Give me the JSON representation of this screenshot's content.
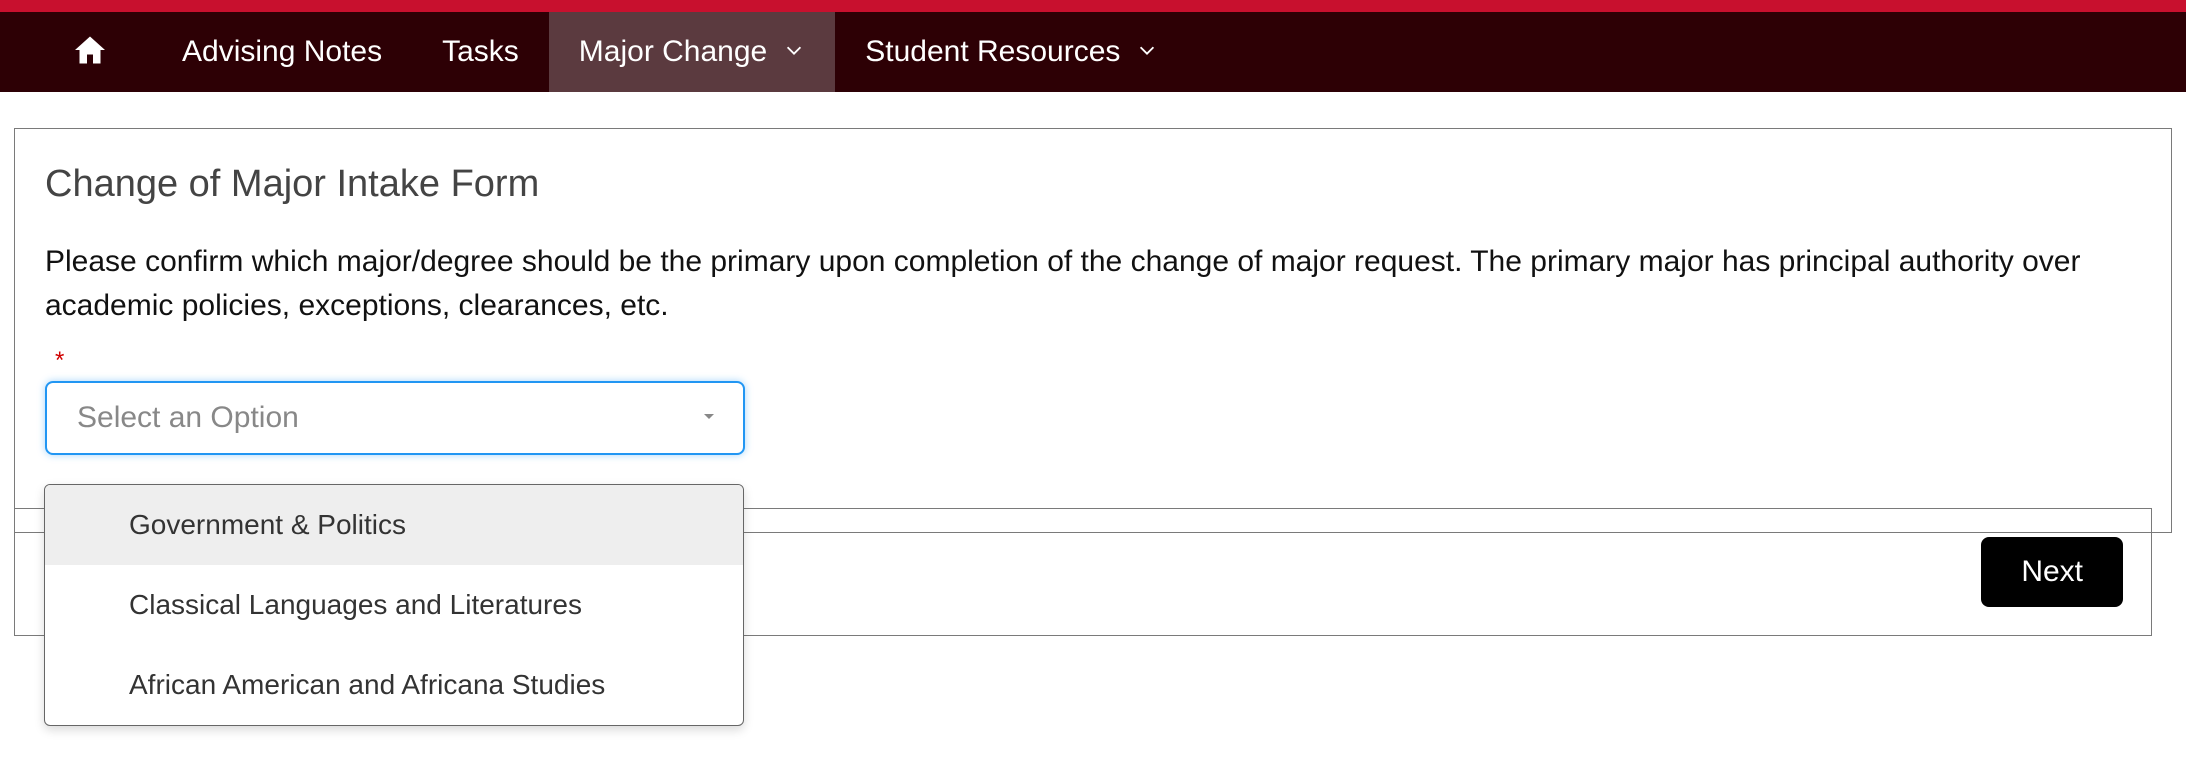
{
  "nav": {
    "items": [
      {
        "label": "Advising Notes"
      },
      {
        "label": "Tasks"
      },
      {
        "label": "Major Change"
      },
      {
        "label": "Student Resources"
      }
    ]
  },
  "form": {
    "title": "Change of Major Intake Form",
    "description": "Please confirm which major/degree should be the primary upon completion of the change of major request. The primary major has principal authority over academic policies, exceptions, clearances, etc.",
    "required_mark": "*",
    "select_placeholder": "Select an Option",
    "options": [
      "Government & Politics",
      "Classical Languages and Literatures",
      "African American and Africana Studies"
    ],
    "next_button": "Next"
  }
}
